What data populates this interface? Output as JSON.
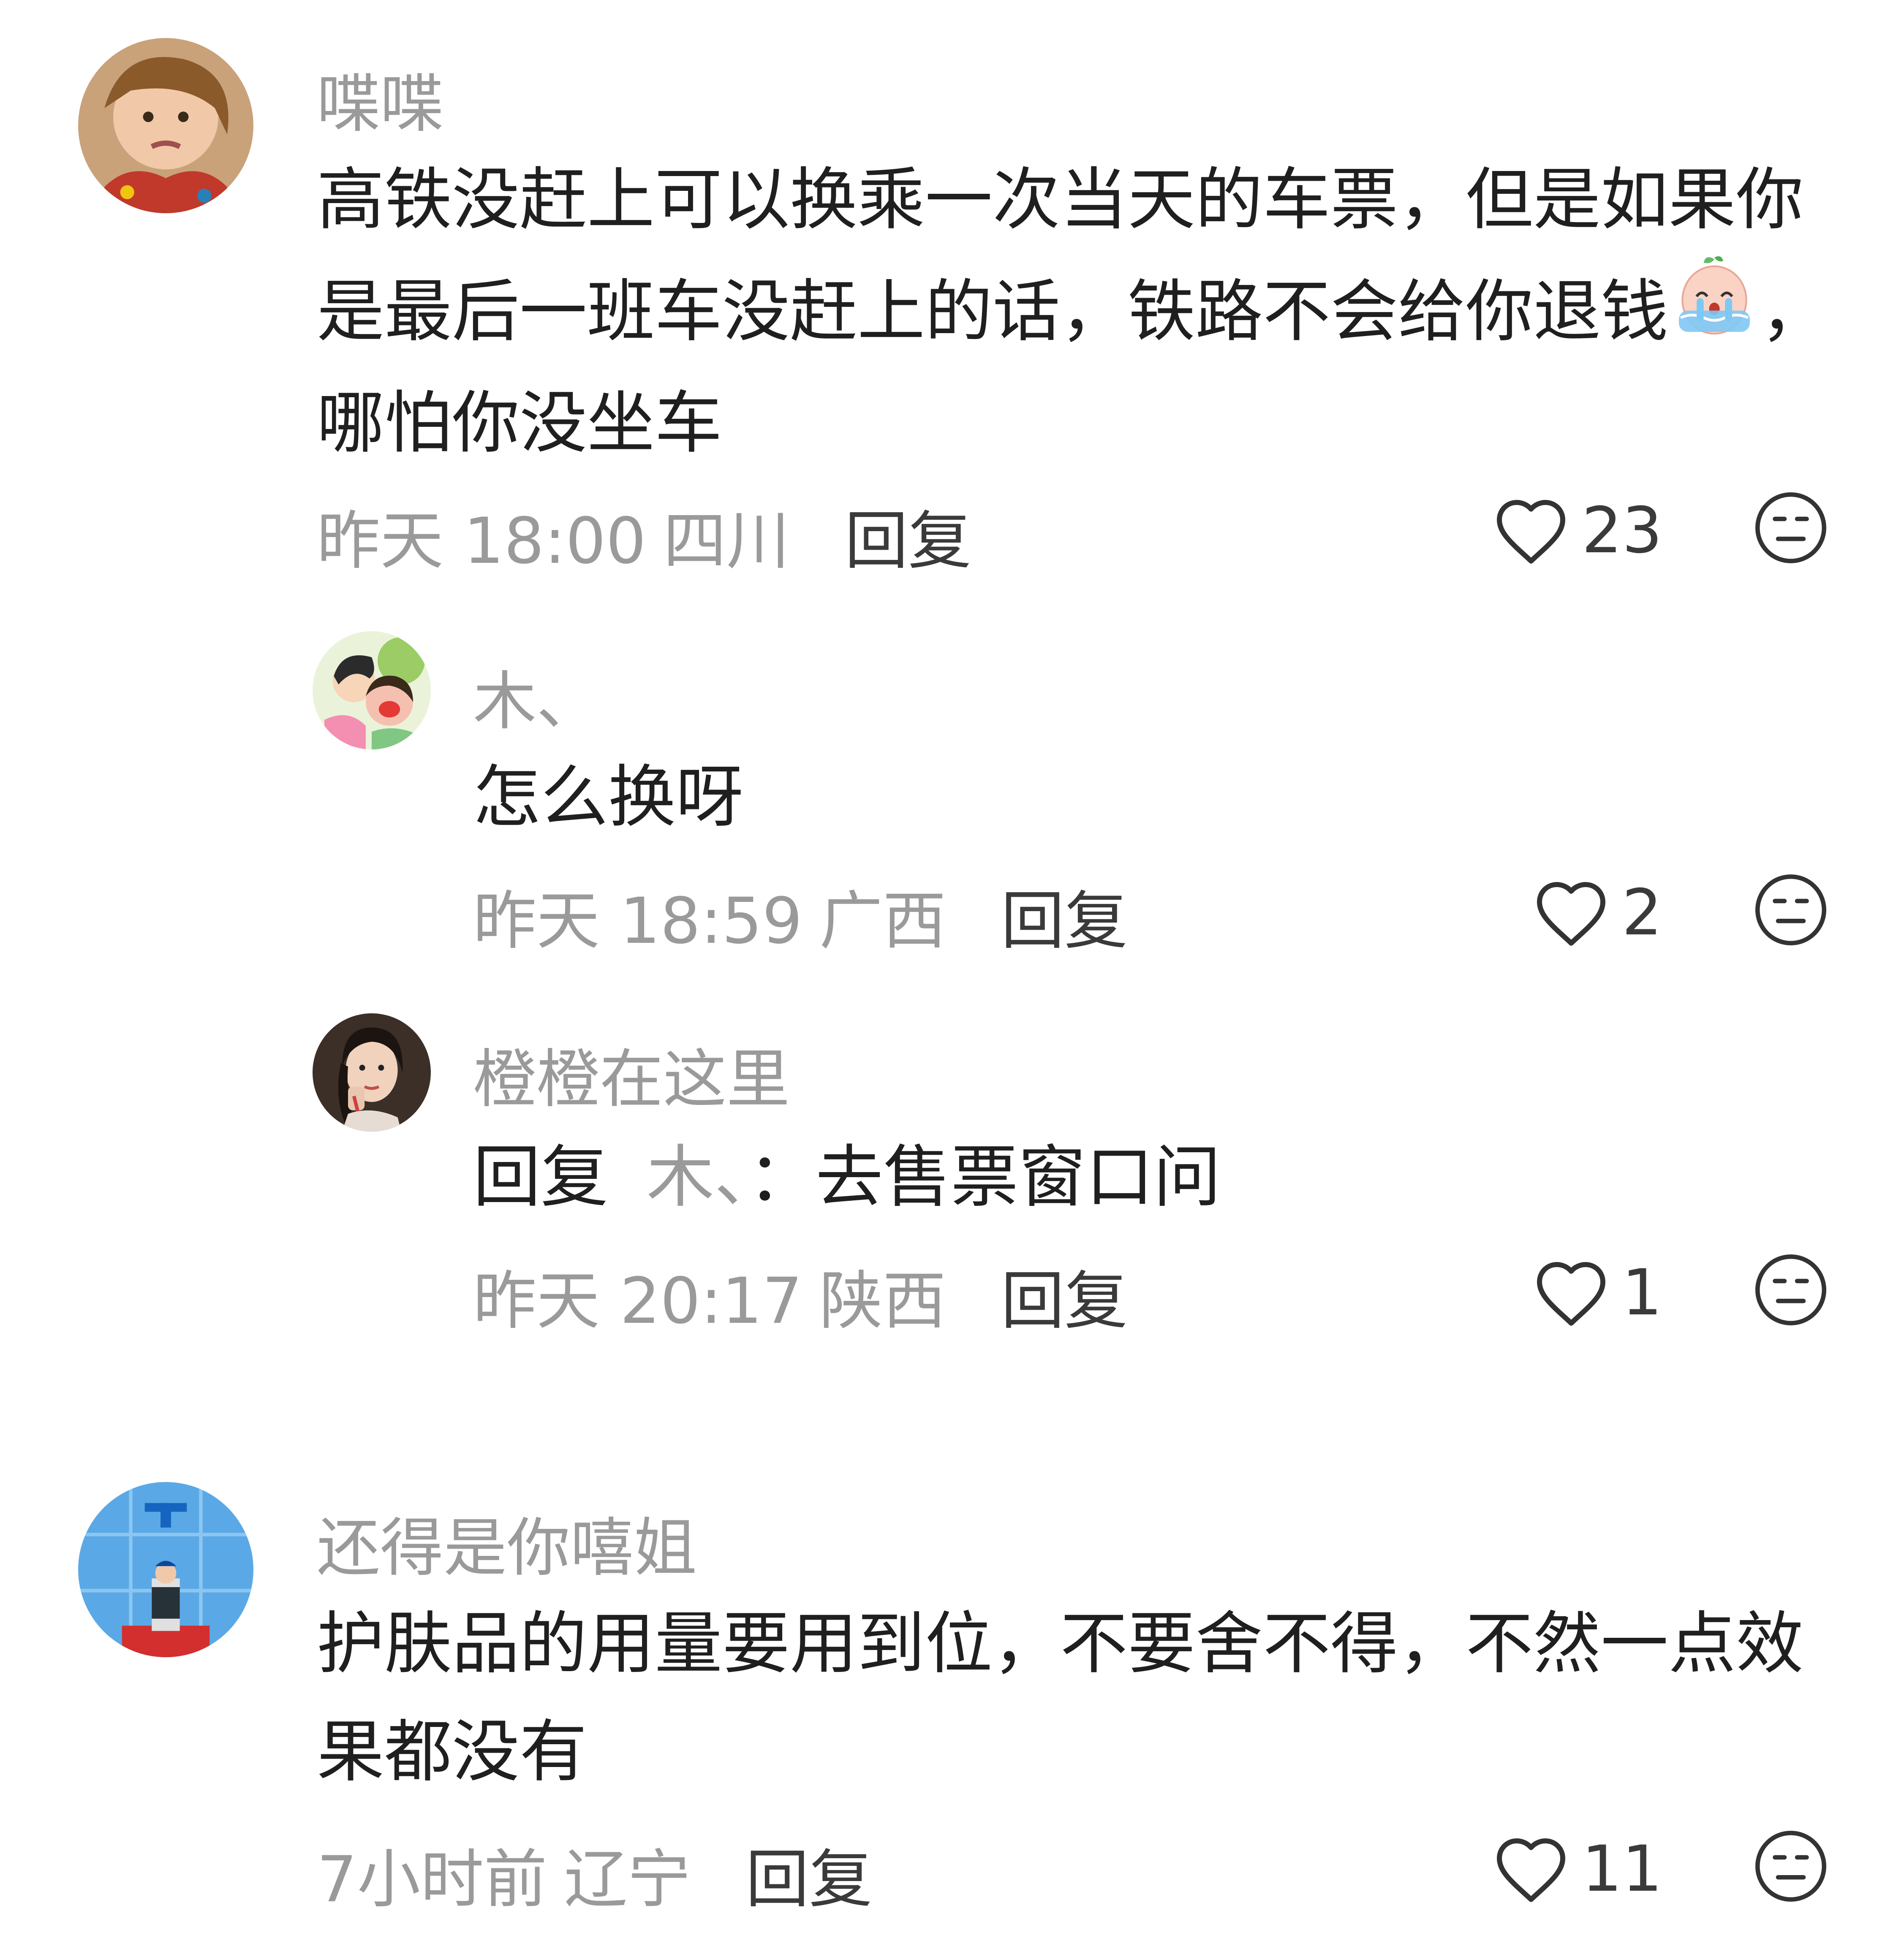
{
  "comments": [
    {
      "username": "喋喋",
      "text_line1": "高铁没赶上可以换乘一次当天的车票，但是如果你",
      "text_line2a": "是最后一班车没赶上的话，铁路不会给你退钱",
      "text_line2b": "，",
      "text_line3": "哪怕你没坐车",
      "emoji": "crying-emoji",
      "time": "昨天 18:00",
      "location": "四川",
      "reply_label": "回复",
      "likes": "23"
    },
    {
      "username": "木、",
      "text": "怎么换呀",
      "time": "昨天 18:59",
      "location": "广西",
      "reply_label": "回复",
      "likes": "2"
    },
    {
      "username": "橙橙在这里",
      "reply_prefix": "回复",
      "reply_target": "木、",
      "text": "：去售票窗口问",
      "time": "昨天 20:17",
      "location": "陕西",
      "reply_label": "回复",
      "likes": "1"
    },
    {
      "username": "还得是你嘻姐",
      "text_line1": "护肤品的用量要用到位，不要舍不得，不然一点效",
      "text_line2": "果都没有",
      "time": "7小时前",
      "location": "辽宁",
      "reply_label": "回复",
      "likes": "11"
    }
  ],
  "icons": {
    "like": "heart-outline-icon",
    "dislike": "meh-face-icon"
  },
  "colors": {
    "username": "#9a9a9a",
    "text": "#1f1f1f",
    "meta": "#9a9a9a",
    "icon": "#3a3a3a"
  }
}
